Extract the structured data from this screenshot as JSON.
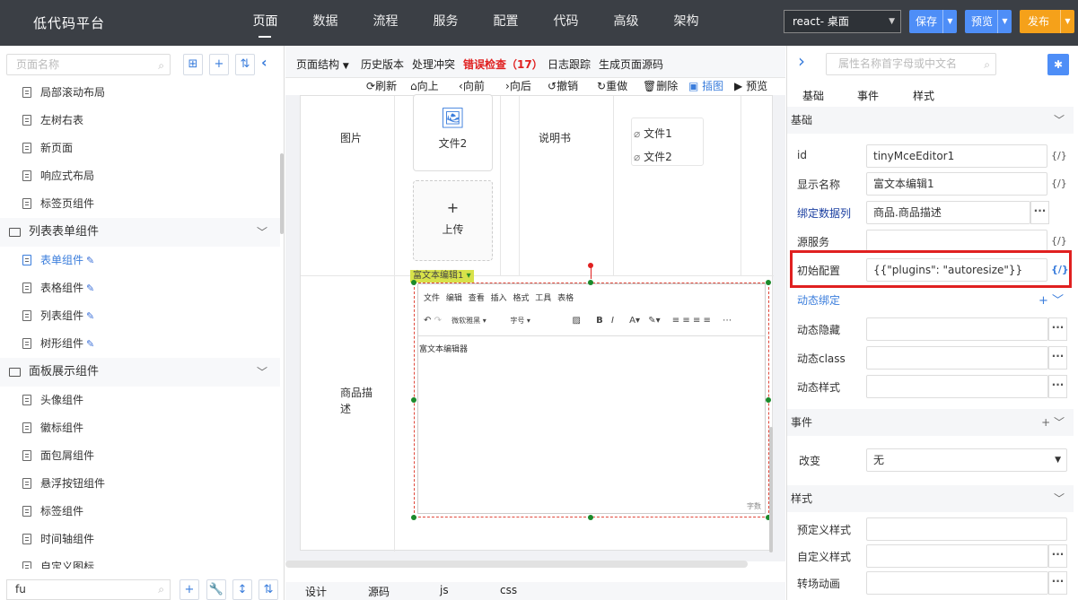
{
  "app": {
    "title": "低代码平台"
  },
  "nav": {
    "items": [
      "页面",
      "数据",
      "流程",
      "服务",
      "配置",
      "代码",
      "高级",
      "架构"
    ],
    "active": "页面"
  },
  "env": {
    "selected": "react- 桌面"
  },
  "buttons": {
    "save": "保存",
    "preview": "预览",
    "publish": "发布"
  },
  "left": {
    "search_placeholder": "页面名称",
    "items_top": [
      "局部滚动布局",
      "左树右表",
      "新页面",
      "响应式布局",
      "标签页组件"
    ],
    "group1": "列表表单组件",
    "group1_items": [
      "表单组件",
      "表格组件",
      "列表组件",
      "树形组件"
    ],
    "group2": "面板展示组件",
    "group2_items": [
      "头像组件",
      "徽标组件",
      "面包屑组件",
      "悬浮按钮组件",
      "标签组件",
      "时间轴组件",
      "自定义图标"
    ],
    "bottom_search_value": "fu"
  },
  "center": {
    "toolbar1": {
      "structure": "页面结构",
      "history": "历史版本",
      "conflict": "处理冲突",
      "errors": "错误检查（17）",
      "log": "日志跟踪",
      "gen": "生成页面源码"
    },
    "toolbar2": {
      "refresh": "刷新",
      "up": "向上",
      "prev": "向前",
      "next": "向后",
      "undo": "撤销",
      "redo": "重做",
      "delete": "删除",
      "insert": "插图",
      "preview": "预览"
    },
    "form": {
      "image_label": "图片",
      "file2": "文件2",
      "upload": "上传",
      "manual_label": "说明书",
      "attachments": [
        "文件1",
        "文件2"
      ],
      "desc_label": "商品描\n述",
      "editor_tag": "富文本编辑1",
      "editor_menu": "文件 编辑 查看 插入 格式 工具 表格",
      "editor_font": "微软雅黑",
      "editor_size": "字号",
      "editor_content": "富文本编辑器",
      "editor_footer_right": "字数"
    },
    "tabs": [
      "设计",
      "源码",
      "js",
      "css"
    ]
  },
  "right": {
    "search_placeholder": "属性名称首字母或中文名",
    "tabs": [
      "基础",
      "事件",
      "样式"
    ],
    "sect_basic": "基础",
    "props": [
      {
        "label": "id",
        "value": "tinyMceEditor1"
      },
      {
        "label": "显示名称",
        "value": "富文本编辑1"
      },
      {
        "label": "绑定数据列",
        "value": "商品.商品描述"
      },
      {
        "label": "源服务",
        "value": ""
      },
      {
        "label": "初始配置",
        "value": "{{\"plugins\": \"autoresize\"}}"
      }
    ],
    "dyn_bind": "动态绑定",
    "dyn_props": [
      "动态隐藏",
      "动态class",
      "动态样式"
    ],
    "sect_event": "事件",
    "event_label": "改变",
    "event_value": "无",
    "sect_style": "样式",
    "style_props": [
      "预定义样式",
      "自定义样式",
      "转场动画"
    ]
  }
}
